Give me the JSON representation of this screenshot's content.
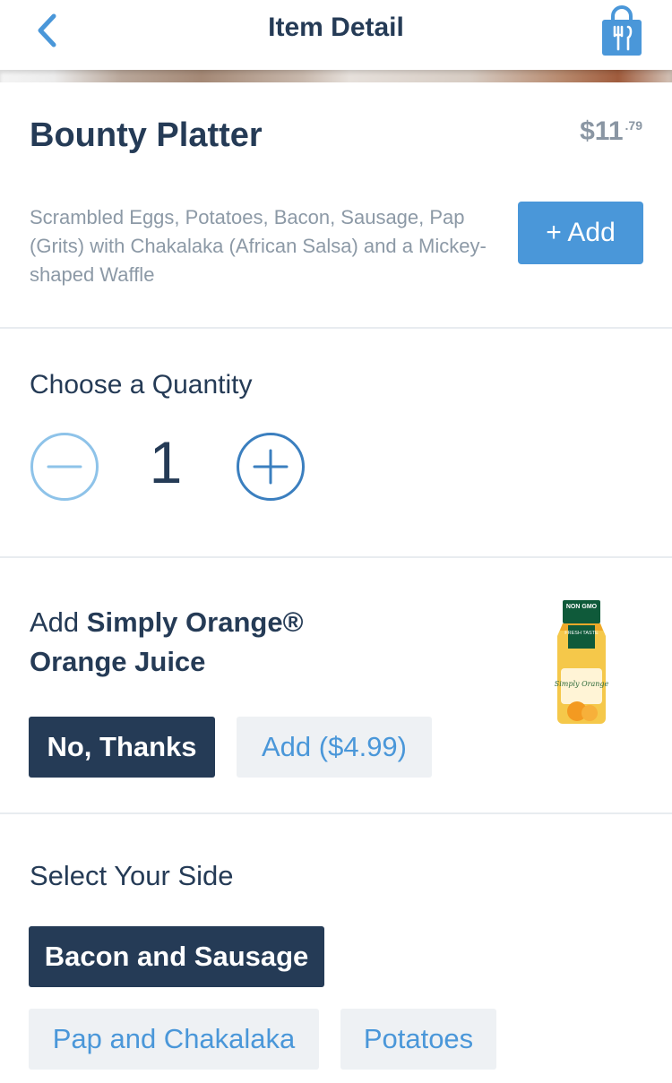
{
  "header": {
    "title": "Item Detail",
    "back_icon": "chevron-left-icon",
    "bag_icon": "shopping-bag-icon"
  },
  "item": {
    "name": "Bounty Platter",
    "price_dollars": "$11",
    "price_cents": ".79",
    "description": "Scrambled Eggs, Potatoes, Bacon, Sausage, Pap (Grits) with Chakalaka (African Salsa) and a Mickey-shaped Waffle",
    "add_label": "+ Add"
  },
  "quantity": {
    "title": "Choose a Quantity",
    "value": "1",
    "decrement_icon": "minus-icon",
    "increment_icon": "plus-icon"
  },
  "upsell": {
    "prefix": "Add ",
    "product_line1": "Simply Orange®",
    "product_line2": "Orange Juice",
    "image_labels": [
      "NON GMO",
      "FRESH TASTE",
      "Simply Orange"
    ],
    "options": [
      {
        "label": "No, Thanks",
        "selected": true
      },
      {
        "label": "Add ($4.99)",
        "selected": false
      }
    ]
  },
  "side": {
    "title": "Select Your Side",
    "options": [
      {
        "label": "Bacon and Sausage",
        "selected": true
      },
      {
        "label": "Pap and Chakalaka",
        "selected": false
      },
      {
        "label": "Potatoes",
        "selected": false
      }
    ]
  },
  "colors": {
    "navy": "#253b56",
    "accent_blue": "#4a97d9",
    "muted_text": "#8c99a6",
    "chip_bg": "#eef1f4",
    "divider": "#e8ecf0"
  }
}
